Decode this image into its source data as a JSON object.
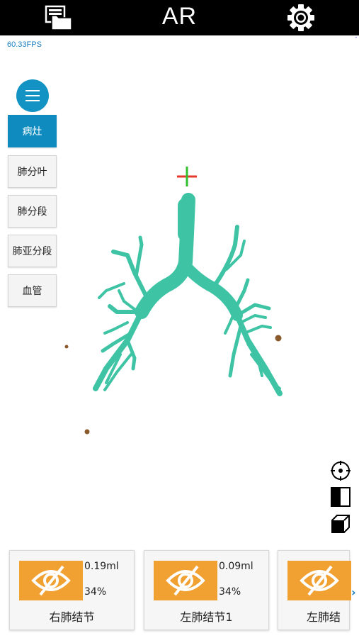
{
  "header": {
    "title": "AR",
    "files_icon": "files-folder-icon",
    "settings_icon": "gear-icon"
  },
  "fps": "60.33FPS",
  "sidebar": {
    "menu_icon": "hamburger-menu-icon",
    "items": [
      {
        "label": "病灶",
        "active": true
      },
      {
        "label": "肺分叶",
        "active": false
      },
      {
        "label": "肺分段",
        "active": false
      },
      {
        "label": "肺亚分段",
        "active": false
      },
      {
        "label": "血管",
        "active": false
      }
    ]
  },
  "tools": [
    "target-icon",
    "contrast-icon",
    "cube-icon"
  ],
  "nodules": [
    {
      "volume": "0.19ml",
      "percent": "34%",
      "name": "右肺结节"
    },
    {
      "volume": "0.09ml",
      "percent": "34%",
      "name": "左肺结节1"
    },
    {
      "volume": "",
      "percent": "",
      "name": "左肺结"
    }
  ],
  "colors": {
    "accent": "#0f8bc0",
    "airway": "#3ec4a4",
    "eye_button": "#f1a132",
    "crosshair_h": "#e53b2a",
    "crosshair_v": "#2fbf2f",
    "nodule": "#8a5a2c"
  }
}
